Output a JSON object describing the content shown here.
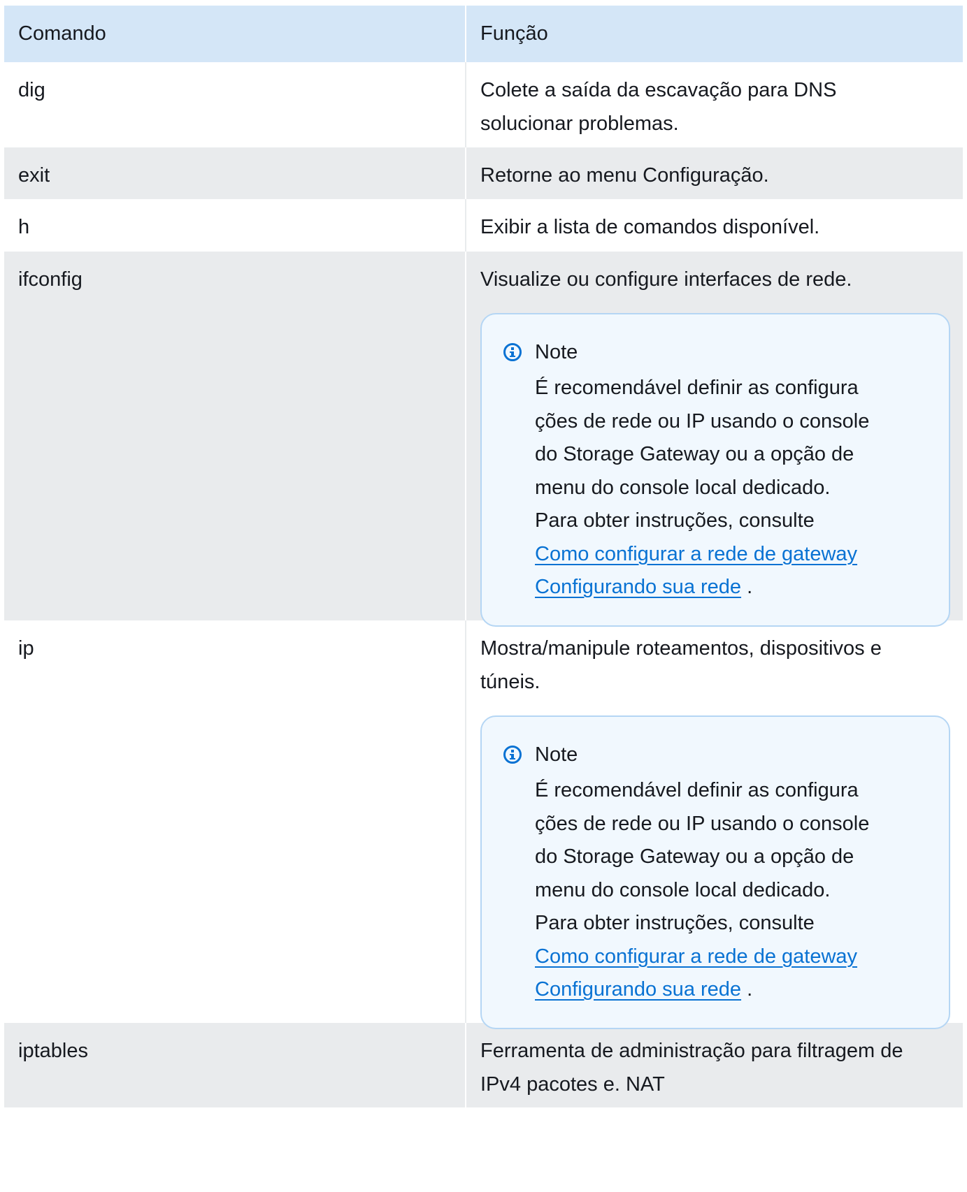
{
  "table": {
    "headers": [
      "Comando",
      "Função"
    ],
    "rows": [
      {
        "command": "dig",
        "function_lines": [
          "Colete a saída da escavação para DNS",
          "solucionar problemas."
        ]
      },
      {
        "command": "exit",
        "function_lines": [
          "Retorne ao menu Configuração."
        ]
      },
      {
        "command": "h",
        "function_lines": [
          "Exibir a lista de comandos disponível."
        ]
      },
      {
        "command": "ifconfig",
        "function_lines": [
          "Visualize ou configure interfaces de rede."
        ],
        "note": {
          "title": "Note",
          "lines": [
            "É recomendável definir as configura",
            "ções de rede ou IP usando o console",
            "do Storage Gateway ou a opção de",
            "menu do console local dedicado.",
            "Para obter instruções, consulte"
          ],
          "link1": "Como configurar a rede de gateway",
          "link2": "Configurando sua rede",
          "tail": " ."
        }
      },
      {
        "command": "ip",
        "function_lines": [
          "Mostra/manipule roteamentos, dispositivos e",
          "túneis."
        ],
        "note": {
          "title": "Note",
          "lines": [
            "É recomendável definir as configura",
            "ções de rede ou IP usando o console",
            "do Storage Gateway ou a opção de",
            "menu do console local dedicado.",
            "Para obter instruções, consulte"
          ],
          "link1": "Como configurar a rede de gateway",
          "link2": "Configurando sua rede",
          "tail": " ."
        }
      },
      {
        "command": "iptables",
        "function_lines": [
          "Ferramenta de administração para filtragem de",
          "IPv4 pacotes e. NAT"
        ]
      }
    ]
  },
  "colors": {
    "header_bg": "#d4e6f7",
    "stripe_bg": "#e9ebed",
    "note_bg": "#f1f8fe",
    "note_border": "#b5d6f4",
    "link": "#0972d3",
    "info_icon": "#0972d3"
  },
  "icons": {
    "note_icon": "info-circle-icon"
  }
}
